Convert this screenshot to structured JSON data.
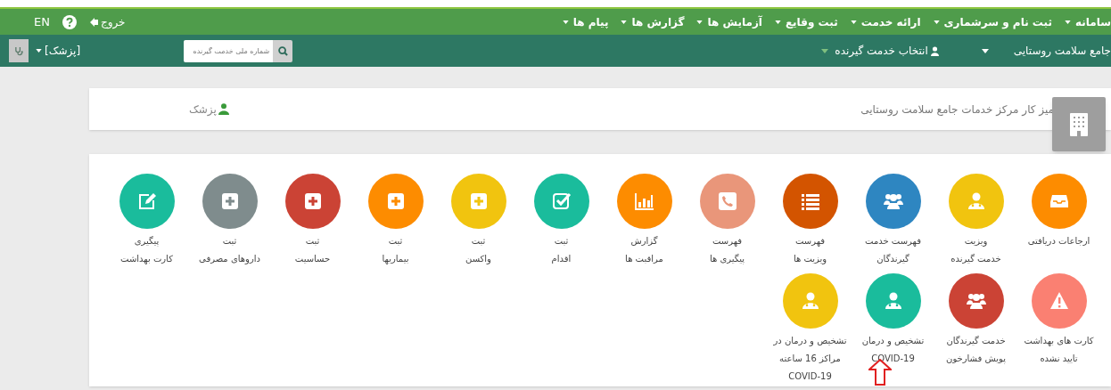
{
  "menu": [
    {
      "label": "سامانه"
    },
    {
      "label": "ثبت نام و سرشماری"
    },
    {
      "label": "ارائه خدمت"
    },
    {
      "label": "ثبت وقایع"
    },
    {
      "label": "آزمایش ها"
    },
    {
      "label": "گزارش ها"
    },
    {
      "label": "پیام ها"
    }
  ],
  "top_left": {
    "logout": "خروج",
    "language": "EN"
  },
  "sub_bar": {
    "center": "جامع سلامت روستایی",
    "client_select": "انتخاب خدمت گیرنده",
    "search_placeholder": "شماره ملی خدمت گیرنده",
    "role": "[پزشک]"
  },
  "header": {
    "title": "میز کار مرکز خدمات جامع سلامت روستایی",
    "role": "پزشک"
  },
  "tiles": [
    {
      "kind": "inbox",
      "color": "#fd8c00",
      "lines": [
        "ارجاعات دریافتی"
      ]
    },
    {
      "kind": "doctor",
      "color": "#f1c40f",
      "lines": [
        "ویزیت",
        "خدمت گیرنده"
      ]
    },
    {
      "kind": "users",
      "color": "#2e86c1",
      "lines": [
        "فهرست خدمت",
        "گیرندگان"
      ]
    },
    {
      "kind": "list",
      "color": "#d35400",
      "lines": [
        "فهرست",
        "ویزیت ها"
      ]
    },
    {
      "kind": "phone",
      "color": "#e9967a",
      "lines": [
        "فهرست",
        "پیگیری ها"
      ]
    },
    {
      "kind": "chart",
      "color": "#fd8c00",
      "lines": [
        "گزارش",
        "مراقبت ها"
      ]
    },
    {
      "kind": "check",
      "color": "#1abc9c",
      "lines": [
        "ثبت",
        "اقدام"
      ]
    },
    {
      "kind": "plus",
      "color": "#f1c40f",
      "lines": [
        "ثبت",
        "واکسن"
      ]
    },
    {
      "kind": "plus",
      "color": "#fd8c00",
      "lines": [
        "ثبت",
        "بیماریها"
      ]
    },
    {
      "kind": "plus",
      "color": "#cb4335",
      "lines": [
        "ثبت",
        "حساسیت"
      ]
    },
    {
      "kind": "plus",
      "color": "#7f8c8d",
      "lines": [
        "ثبت",
        "داروهای مصرفی"
      ]
    },
    {
      "kind": "edit",
      "color": "#1abc9c",
      "lines": [
        "پیگیری",
        "کارت بهداشت"
      ]
    },
    {
      "kind": "warning",
      "color": "#fa8072",
      "lines": [
        "کارت های بهداشت",
        "تایید نشده"
      ]
    },
    {
      "kind": "users",
      "color": "#cb4335",
      "lines": [
        "خدمت گیرندگان",
        "پویش فشارخون"
      ]
    },
    {
      "kind": "doctor",
      "color": "#1abc9c",
      "lines": [
        "تشخیص و درمان",
        "COVID-19"
      ]
    },
    {
      "kind": "doctor",
      "color": "#f1c40f",
      "lines": [
        "تشخیص و درمان در",
        "مراکز 16 ساعته",
        "COVID-19"
      ]
    }
  ]
}
